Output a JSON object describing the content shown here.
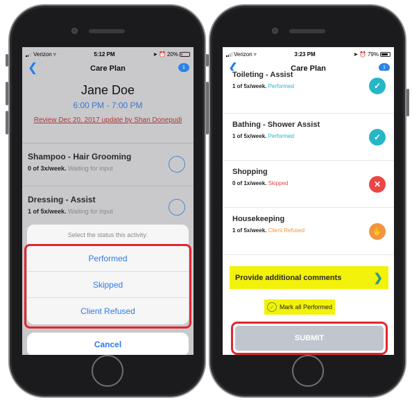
{
  "left_phone": {
    "status": {
      "carrier": "Verizon",
      "time": "5:12 PM",
      "battery": "20%"
    },
    "nav": {
      "title": "Care Plan",
      "badge": "1"
    },
    "patient": {
      "name": "Jane Doe",
      "time_range": "6:00 PM - 7:00 PM"
    },
    "review_link": "Review Dec 20, 2017 update by Shan Donepudi",
    "items": [
      {
        "title": "Shampoo - Hair Grooming",
        "count": "0 of 3x/week.",
        "state": "Waiting for input"
      },
      {
        "title": "Dressing - Assist",
        "count": "1 of 5x/week.",
        "state": "Waiting for input"
      }
    ],
    "sheet": {
      "prompt": "Select the status this activity:",
      "options": [
        "Performed",
        "Skipped",
        "Client Refused"
      ],
      "cancel": "Cancel"
    }
  },
  "right_phone": {
    "status": {
      "carrier": "Verizon",
      "time": "3:23 PM",
      "battery": "79%"
    },
    "nav": {
      "title": "Care Plan",
      "badge": "1"
    },
    "items": [
      {
        "title": "Toileting - Assist",
        "count": "1 of 5x/week.",
        "state": "Performed"
      },
      {
        "title": "Bathing - Shower Assist",
        "count": "1 of 5x/week.",
        "state": "Performed"
      },
      {
        "title": "Shopping",
        "count": "0 of 1x/week.",
        "state": "Skipped"
      },
      {
        "title": "Housekeeping",
        "count": "1 of 5x/week.",
        "state": "Client Refused"
      }
    ],
    "comments_label": "Provide additional comments",
    "mark_all_label": "Mark all Performed",
    "submit_label": "SUBMIT"
  },
  "colors": {
    "accent_blue": "#2f7ae5",
    "highlight_red": "#e0262e",
    "highlight_yellow": "#f2f20a",
    "performed": "#26b6c8",
    "skipped": "#ee4444",
    "refused": "#f39440"
  },
  "icons": {
    "back": "chevron-left-icon",
    "chat": "chat-bubble-icon",
    "performed": "check-icon",
    "skipped": "x-icon",
    "refused": "hand-icon",
    "comments": "chevron-right-icon"
  }
}
